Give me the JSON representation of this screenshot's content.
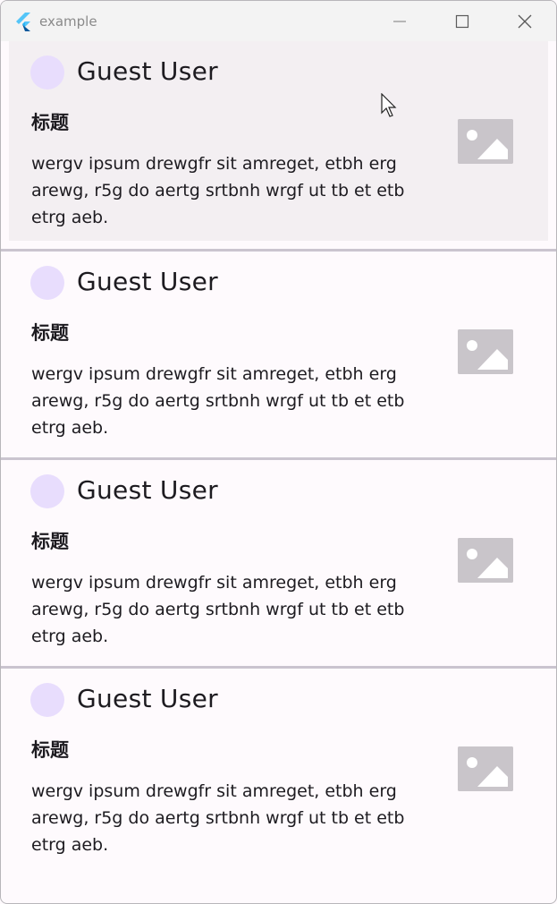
{
  "window": {
    "title": "example",
    "controls": {
      "minimize": "minimize-icon",
      "maximize": "maximize-icon",
      "close": "close-icon"
    }
  },
  "colors": {
    "background": "#fefafd",
    "hover": "#f3eff2",
    "avatar": "#e8ddfd",
    "placeholder": "#c9c5ca",
    "divider": "#cac4cf",
    "text": "#1d1b20"
  },
  "posts": [
    {
      "user": "Guest User",
      "title": "标题",
      "body": "wergv ipsum drewgfr sit amreget, etbh erg arewg, r5g do aertg srtbnh wrgf ut tb et etb etrg aeb.",
      "image_icon": "image-placeholder-icon"
    },
    {
      "user": "Guest User",
      "title": "标题",
      "body": "wergv ipsum drewgfr sit amreget, etbh erg arewg, r5g do aertg srtbnh wrgf ut tb et etb etrg aeb.",
      "image_icon": "image-placeholder-icon"
    },
    {
      "user": "Guest User",
      "title": "标题",
      "body": "wergv ipsum drewgfr sit amreget, etbh erg arewg, r5g do aertg srtbnh wrgf ut tb et etb etrg aeb.",
      "image_icon": "image-placeholder-icon"
    },
    {
      "user": "Guest User",
      "title": "标题",
      "body": "wergv ipsum drewgfr sit amreget, etbh erg arewg, r5g do aertg srtbnh wrgf ut tb et etb etrg aeb.",
      "image_icon": "image-placeholder-icon"
    }
  ]
}
